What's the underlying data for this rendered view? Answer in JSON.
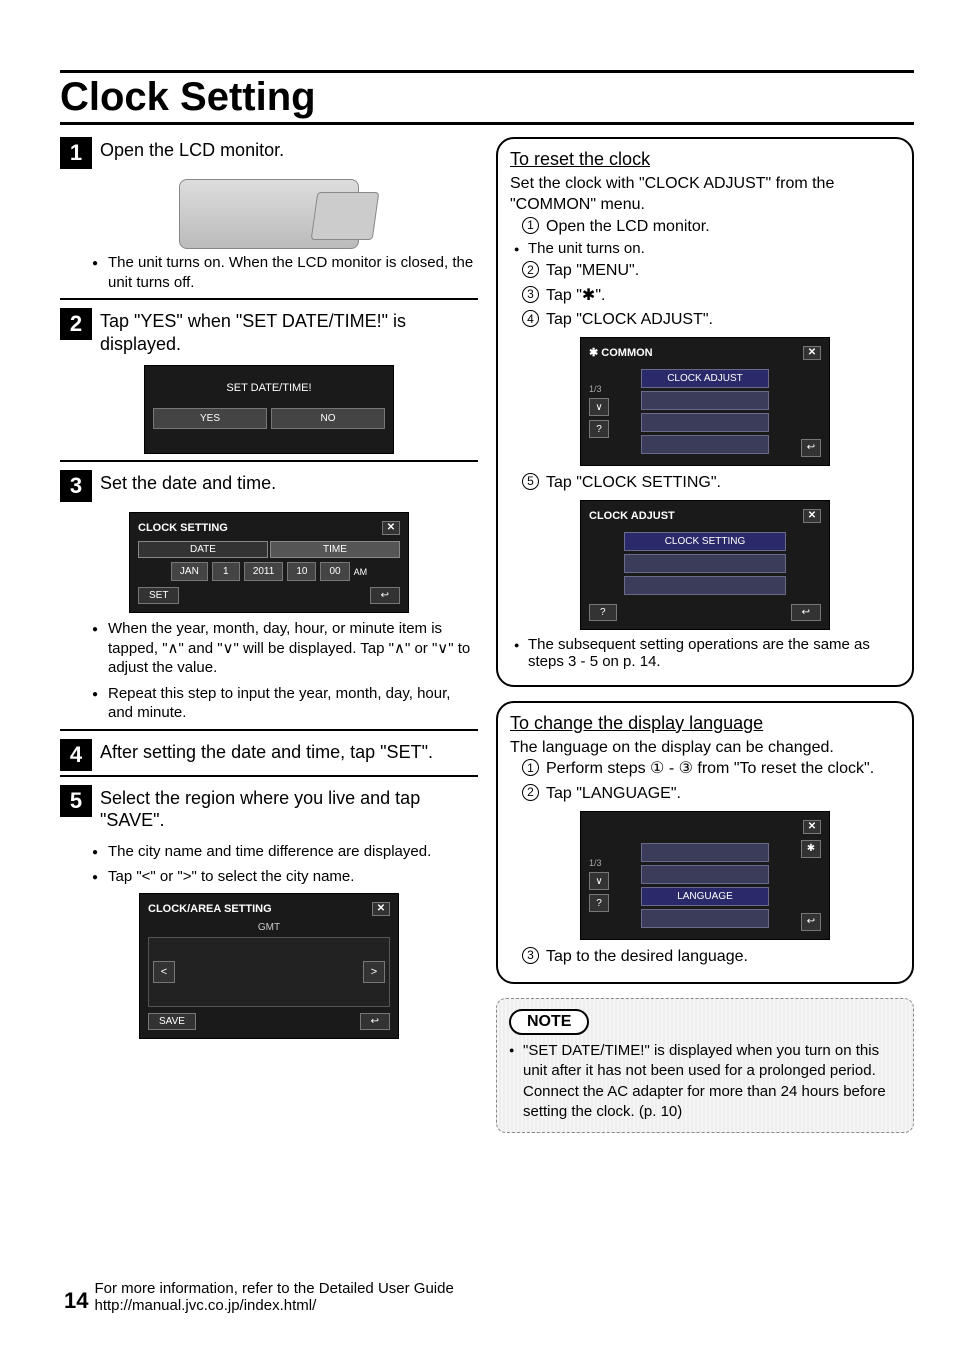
{
  "title": "Clock Setting",
  "steps": {
    "s1": {
      "num": "1",
      "text": "Open the LCD monitor.",
      "bullet1": "The unit turns on. When the LCD monitor is closed, the unit turns off."
    },
    "s2": {
      "num": "2",
      "text": "Tap \"YES\" when \"SET DATE/TIME!\" is displayed.",
      "scr_title": "SET DATE/TIME!",
      "yes": "YES",
      "no": "NO"
    },
    "s3": {
      "num": "3",
      "text": "Set the date and time.",
      "scr_title": "CLOCK SETTING",
      "tab_date": "DATE",
      "tab_time": "TIME",
      "jan": "JAN",
      "d": "1",
      "y": "2011",
      "h": "10",
      "m": "00",
      "ampm": "AM",
      "set": "SET",
      "b1": "When the year, month, day, hour, or minute item is tapped, \"∧\" and \"∨\" will be displayed. Tap \"∧\" or \"∨\" to adjust the value.",
      "b2": "Repeat this step to input the year, month, day, hour, and minute."
    },
    "s4": {
      "num": "4",
      "text": "After setting the date and time, tap \"SET\"."
    },
    "s5": {
      "num": "5",
      "text": "Select the region where you live and tap \"SAVE\".",
      "b1": "The city name and time difference are displayed.",
      "b2": "Tap \"<\" or \">\" to select the city name.",
      "scr_title": "CLOCK/AREA SETTING",
      "gmt": "GMT",
      "save": "SAVE"
    }
  },
  "reset": {
    "hdr": "To reset the clock",
    "p1": "Set the clock with \"CLOCK ADJUST\" from the \"COMMON\" menu.",
    "l1": "Open the LCD monitor.",
    "sub1": "The unit turns on.",
    "l2": "Tap \"MENU\".",
    "l3": "Tap \"✱\".",
    "l4": "Tap \"CLOCK ADJUST\".",
    "scr4_title": "COMMON",
    "scr4_item": "CLOCK ADJUST",
    "scr4_page": "1/3",
    "l5": "Tap \"CLOCK SETTING\".",
    "scr5_title": "CLOCK ADJUST",
    "scr5_item": "CLOCK SETTING",
    "sub2": "The subsequent setting operations are the same as steps 3 - 5 on p. 14."
  },
  "lang": {
    "hdr": "To change the display language",
    "p1": "The language on the display can be changed.",
    "l1": "Perform steps ① - ③ from \"To reset the clock\".",
    "l2": "Tap \"LANGUAGE\".",
    "scr_item": "LANGUAGE",
    "scr_page": "1/3",
    "l3": "Tap to the desired language."
  },
  "note": {
    "tag": "NOTE",
    "b1": "\"SET DATE/TIME!\" is displayed when you turn on this unit after it has not been used for a prolonged period. Connect the AC adapter for more than 24 hours before setting the clock. (p. 10)"
  },
  "footer": {
    "page": "14",
    "line1": "For more information, refer to the Detailed User Guide",
    "line2": "http://manual.jvc.co.jp/index.html/"
  },
  "icons": {
    "close": "✕",
    "return": "↩",
    "left": "<",
    "right": ">",
    "down": "∨",
    "gear": "✱",
    "help": "?"
  }
}
